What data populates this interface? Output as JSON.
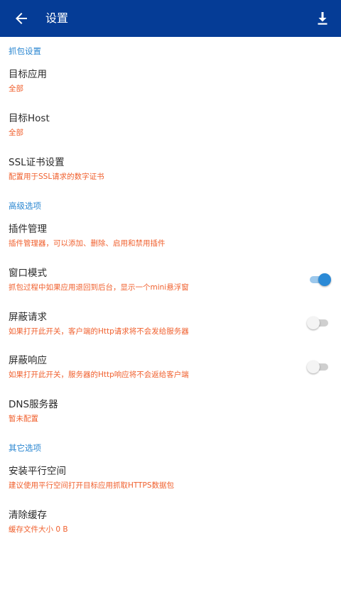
{
  "appbar": {
    "title": "设置",
    "back_icon": "arrow-back-icon",
    "action_icon": "download-icon"
  },
  "colors": {
    "appbar": "#053c96",
    "section_header": "#2b87d1",
    "summary": "#f0602e",
    "switch_on": "#2b8ad6"
  },
  "sections": [
    {
      "header": "抓包设置",
      "items": [
        {
          "title": "目标应用",
          "summary": "全部"
        },
        {
          "title": "目标Host",
          "summary": "全部"
        },
        {
          "title": "SSL证书设置",
          "summary": "配置用于SSL请求的数字证书"
        }
      ]
    },
    {
      "header": "高级选项",
      "items": [
        {
          "title": "插件管理",
          "summary": "插件管理器，可以添加、删除、启用和禁用插件"
        },
        {
          "title": "窗口模式",
          "summary": "抓包过程中如果应用退回到后台，显示一个mini悬浮窗",
          "switch": true
        },
        {
          "title": "屏蔽请求",
          "summary": "如果打开此开关，客户端的Http请求将不会发给服务器",
          "switch": false
        },
        {
          "title": "屏蔽响应",
          "summary": "如果打开此开关，服务器的Http响应将不会返给客户端",
          "switch": false
        },
        {
          "title": "DNS服务器",
          "summary": "暂未配置"
        }
      ]
    },
    {
      "header": "其它选项",
      "items": [
        {
          "title": "安装平行空间",
          "summary": "建议使用平行空间打开目标应用抓取HTTPS数据包"
        },
        {
          "title": "清除缓存",
          "summary": "缓存文件大小 0 B"
        }
      ]
    }
  ]
}
